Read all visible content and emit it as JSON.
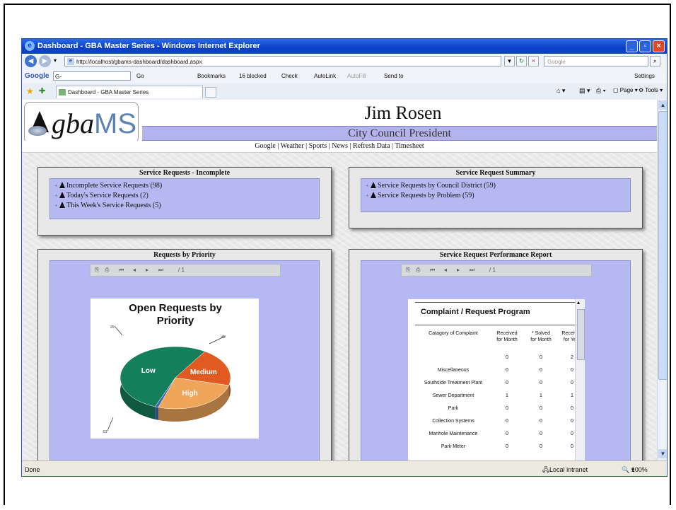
{
  "window": {
    "title": "Dashboard - GBA Master Series - Windows Internet Explorer",
    "url": "http://localhost/gbams-dashboard/dashboard.aspx",
    "search_placeholder": "Google"
  },
  "google_bar": {
    "logo": "Google",
    "input": "G-",
    "go": "Go",
    "bookmarks": "Bookmarks",
    "blocked": "16 blocked",
    "check": "Check",
    "autolink": "AutoLink",
    "autofill": "AutoFill",
    "send_to": "Send to",
    "settings": "Settings"
  },
  "tab": {
    "label": "Dashboard - GBA Master Series",
    "page_menu": "Page",
    "tools_menu": "Tools"
  },
  "header": {
    "logo_text": "gba",
    "logo_accent": "MS",
    "user_name": "Jim Rosen",
    "user_title": "City Council President"
  },
  "links": [
    "Google",
    "Weather",
    "Sports",
    "News",
    "Refresh Data",
    "Timesheet"
  ],
  "panels": {
    "incomplete": {
      "title": "Service Requests - Incomplete",
      "items": [
        "Incomplete Service Requests (98)",
        "Today's Service Requests (2)",
        "This Week's Service Requests (5)"
      ]
    },
    "summary": {
      "title": "Service Request Summary",
      "items": [
        "Service Requests by Council District (59)",
        "Service Requests by Problem (59)"
      ]
    },
    "priority": {
      "title": "Requests by Priority",
      "page_indicator": "/ 1"
    },
    "performance": {
      "title": "Service Request Performance Report",
      "page_indicator": "/ 1"
    }
  },
  "chart_data": {
    "type": "pie",
    "title": "Open Requests by Priority",
    "slices": [
      {
        "label": "Low",
        "value": 53,
        "color": "#157f5b"
      },
      {
        "label": "Medium",
        "value": 20,
        "color": "#e05a22"
      },
      {
        "label": "High",
        "value": 26,
        "color": "#f0a65a"
      },
      {
        "label": "",
        "value": 1,
        "color": "#3e6aa8"
      }
    ],
    "callouts": [
      "25",
      "45",
      "53"
    ]
  },
  "report": {
    "title": "Complaint / Request Program",
    "columns": [
      "Catagory of Complaint",
      "Received for Month",
      "* Solved for Month",
      "Received for Year"
    ],
    "rows": [
      [
        "",
        "0",
        "0",
        "2"
      ],
      [
        "Miscellaneous",
        "0",
        "0",
        "0"
      ],
      [
        "Southside Treatment Plant",
        "0",
        "0",
        "0"
      ],
      [
        "Sewer Department",
        "1",
        "1",
        "1"
      ],
      [
        "Park",
        "0",
        "0",
        "0"
      ],
      [
        "Collection Systems",
        "0",
        "0",
        "0"
      ],
      [
        "Manhole Maintenance",
        "0",
        "0",
        "0"
      ],
      [
        "Park Meter",
        "0",
        "0",
        "0"
      ]
    ]
  },
  "status": {
    "left": "Done",
    "zone": "Local intranet",
    "zoom": "100%"
  }
}
